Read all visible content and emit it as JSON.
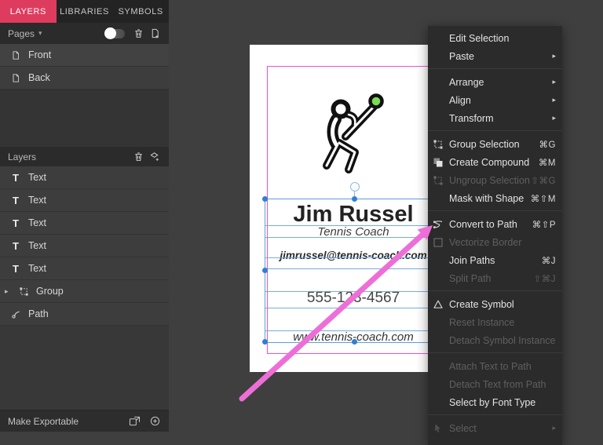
{
  "sidebar": {
    "tabs": [
      {
        "label": "LAYERS",
        "active": true
      },
      {
        "label": "LIBRARIES",
        "active": false
      },
      {
        "label": "SYMBOLS",
        "active": false
      }
    ],
    "pages": {
      "title": "Pages",
      "items": [
        {
          "label": "Front"
        },
        {
          "label": "Back"
        }
      ]
    },
    "layers": {
      "title": "Layers",
      "items": [
        {
          "label": "Text",
          "type": "text"
        },
        {
          "label": "Text",
          "type": "text"
        },
        {
          "label": "Text",
          "type": "text"
        },
        {
          "label": "Text",
          "type": "text"
        },
        {
          "label": "Text",
          "type": "text"
        },
        {
          "label": "Group",
          "type": "group"
        },
        {
          "label": "Path",
          "type": "path"
        }
      ]
    },
    "footer": {
      "label": "Make Exportable"
    }
  },
  "card": {
    "name": "Jim Russel",
    "role": "Tennis Coach",
    "email": "jimrussel@tennis-coach.com",
    "phone": "555-123-4567",
    "website": "www.tennis-coach.com"
  },
  "context_menu": {
    "items": [
      {
        "label": "Edit Selection"
      },
      {
        "label": "Paste",
        "submenu": true
      },
      {
        "label": "Arrange",
        "submenu": true
      },
      {
        "label": "Align",
        "submenu": true
      },
      {
        "label": "Transform",
        "submenu": true
      },
      {
        "label": "Group Selection",
        "shortcut": "⌘G",
        "icon": "group-icon"
      },
      {
        "label": "Create Compound",
        "shortcut": "⌘M",
        "icon": "compound-icon"
      },
      {
        "label": "Ungroup Selection",
        "shortcut": "⇧⌘G",
        "disabled": true,
        "icon": "ungroup-icon"
      },
      {
        "label": "Mask with Shape",
        "shortcut": "⌘⇧M"
      },
      {
        "label": "Convert to Path",
        "shortcut": "⌘⇧P",
        "icon": "convert-to-path-icon"
      },
      {
        "label": "Vectorize Border",
        "disabled": true,
        "icon": "vectorize-border-icon"
      },
      {
        "label": "Join Paths",
        "shortcut": "⌘J"
      },
      {
        "label": "Split Path",
        "shortcut": "⇧⌘J",
        "disabled": true
      },
      {
        "label": "Create Symbol",
        "icon": "create-symbol-icon"
      },
      {
        "label": "Reset Instance",
        "disabled": true
      },
      {
        "label": "Detach Symbol Instance",
        "disabled": true
      },
      {
        "label": "Attach Text to Path",
        "disabled": true
      },
      {
        "label": "Detach Text from Path",
        "disabled": true
      },
      {
        "label": "Select by Font Type"
      },
      {
        "label": "Select",
        "disabled": true,
        "submenu": true,
        "icon": "cursor-icon"
      }
    ]
  },
  "icons": {
    "caret_down": "▾",
    "caret_right": "▸",
    "submenu_arrow": "▸",
    "text_glyph": "T"
  },
  "colors": {
    "accent_tab": "#dd3c5f",
    "annotation_arrow": "#ee6ed8",
    "selection_blue": "#5f9fd9",
    "page_border_magenta": "#f050d8",
    "tennis_ball_green": "#7ed957",
    "menu_bg": "#2b2b2b",
    "canvas_bg": "#3f3f3f"
  }
}
